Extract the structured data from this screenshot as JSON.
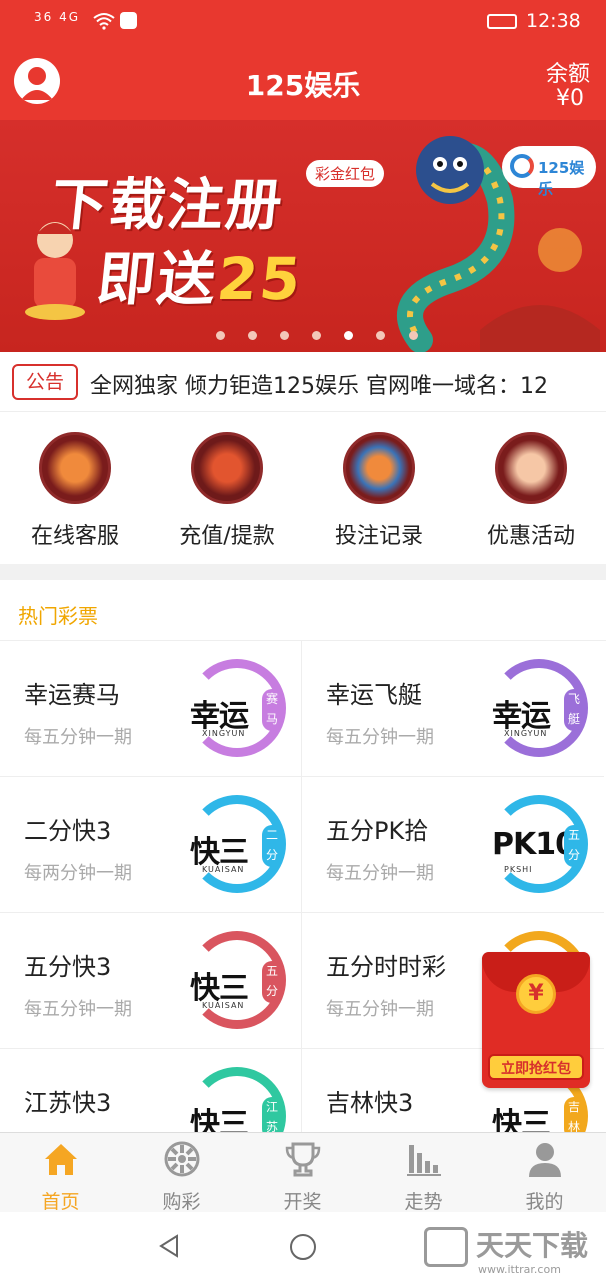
{
  "status": {
    "signal": "36  4G  ",
    "time": "12:38"
  },
  "header": {
    "title": "125娱乐",
    "balance_label": "余额",
    "balance_value": "¥0"
  },
  "banner": {
    "line1": "下载注册",
    "line2_prefix": "即送",
    "line2_amount": "25",
    "badge": "彩金红包",
    "logo": "125娱乐",
    "slides": 7,
    "active_slide": 1
  },
  "notice": {
    "tag": "公告",
    "text": "全网独家 倾力钜造125娱乐 官网唯一域名：12"
  },
  "quick_menu": [
    {
      "label": "在线客服",
      "icon": "horse-emblem-icon",
      "color": "#d7462e"
    },
    {
      "label": "充值/提款",
      "icon": "dragon-emblem-icon",
      "color": "#c23a2a"
    },
    {
      "label": "投注记录",
      "icon": "fish-emblem-icon",
      "color": "#3a73b8"
    },
    {
      "label": "优惠活动",
      "icon": "ox-emblem-icon",
      "color": "#c0392b"
    }
  ],
  "hot": {
    "title": "热门彩票",
    "items": [
      {
        "name": "幸运赛马",
        "period": "每五分钟一期",
        "logo_main": "幸运",
        "logo_sub": "XINGYUN",
        "logo_badge": "赛马",
        "color": "#c77de0"
      },
      {
        "name": "幸运飞艇",
        "period": "每五分钟一期",
        "logo_main": "幸运",
        "logo_sub": "XINGYUN",
        "logo_badge": "飞艇",
        "color": "#9b6fd9"
      },
      {
        "name": "二分快3",
        "period": "每两分钟一期",
        "logo_main": "快三",
        "logo_sub": "KUAISAN",
        "logo_badge": "二分",
        "color": "#2fb7e8"
      },
      {
        "name": "五分PK拾",
        "period": "每五分钟一期",
        "logo_main": "PK10",
        "logo_sub": "PKSHI",
        "logo_badge": "五分",
        "color": "#2fb7e8"
      },
      {
        "name": "五分快3",
        "period": "每五分钟一期",
        "logo_main": "快三",
        "logo_sub": "KUAISAN",
        "logo_badge": "五分",
        "color": "#d9555f"
      },
      {
        "name": "五分时时彩",
        "period": "每五分钟一期",
        "logo_main": "",
        "logo_sub": "",
        "logo_badge": "",
        "color": "#f2a81d"
      },
      {
        "name": "江苏快3",
        "period": "",
        "logo_main": "快三",
        "logo_sub": "",
        "logo_badge": "江苏",
        "color": "#2fc8a0"
      },
      {
        "name": "吉林快3",
        "period": "",
        "logo_main": "快三",
        "logo_sub": "",
        "logo_badge": "吉林",
        "color": "#f2a81d"
      }
    ]
  },
  "red_packet": {
    "symbol": "¥",
    "button": "立即抢红包"
  },
  "tabs": [
    {
      "label": "首页",
      "icon": "home-icon",
      "active": true
    },
    {
      "label": "购彩",
      "icon": "lottery-wheel-icon",
      "active": false
    },
    {
      "label": "开奖",
      "icon": "trophy-icon",
      "active": false
    },
    {
      "label": "走势",
      "icon": "bar-chart-icon",
      "active": false
    },
    {
      "label": "我的",
      "icon": "user-icon",
      "active": false
    }
  ],
  "watermark": {
    "text": "天天下载",
    "url": "www.ittrar.com"
  },
  "colors": {
    "brand_red": "#e8382f",
    "accent_orange": "#f5a623"
  }
}
